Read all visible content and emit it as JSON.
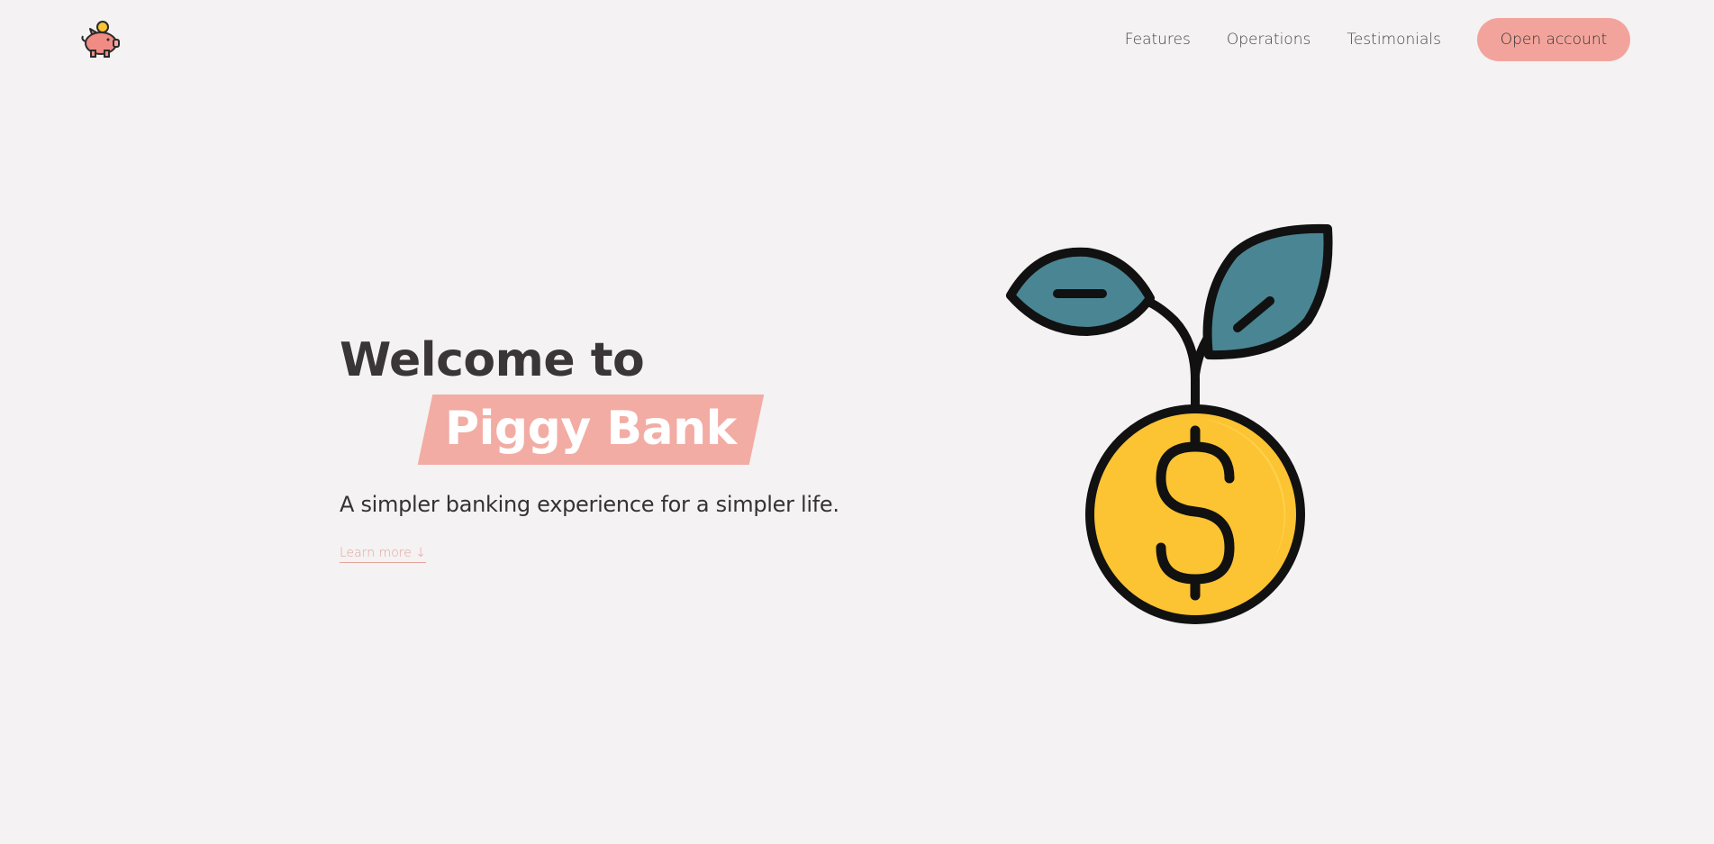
{
  "nav": {
    "logo_icon": "piggy-bank-icon",
    "links": [
      {
        "label": "Features"
      },
      {
        "label": "Operations"
      },
      {
        "label": "Testimonials"
      }
    ],
    "cta_label": "Open account"
  },
  "hero": {
    "title_line1": "Welcome to",
    "title_highlight": "Piggy Bank",
    "subtitle": "A simpler banking experience for a simpler life.",
    "learn_more_label": "Learn more ↓",
    "illustration_icon": "money-plant-coin-icon"
  },
  "colors": {
    "background": "#f4f2f3",
    "accent": "#f2aca4",
    "heading": "#3a3536",
    "leaf": "#4a8593",
    "coin": "#fcc332"
  }
}
